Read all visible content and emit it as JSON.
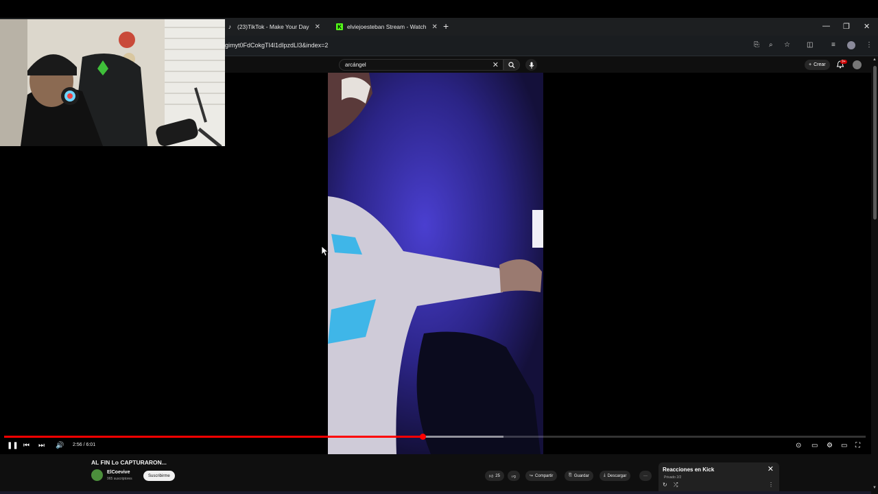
{
  "browser": {
    "tabs": [
      {
        "title": "(23)TikTok - Make Your Day",
        "icon": "tiktok-icon"
      },
      {
        "title": "elviejoesteban Stream - Watch",
        "icon": "kick-icon"
      }
    ],
    "url": "gimyt0FdCokgTI4l1dIpzdLI3&index=2"
  },
  "youtube": {
    "search_query": "arcángel",
    "create_label": "Crear",
    "notification_count": "9+"
  },
  "player": {
    "time_display": "2:56 / 6:01",
    "played_fraction": 0.486,
    "buffered_fraction": 0.58
  },
  "video": {
    "title": "AL FIN Lo CAPTURARON...",
    "channel": "ElCoevive",
    "subscribers": "965 suscriptores",
    "subscribe_label": "Suscribirme",
    "likes": "25",
    "share_label": "Compartir",
    "save_label": "Guardar",
    "download_label": "Descargar",
    "more_label": "···"
  },
  "playlist": {
    "title": "Reacciones en Kick",
    "subtitle": "Privado 2/2"
  },
  "colors": {
    "progress": "#ff0000",
    "kick_brand": "#53fc18",
    "background": "#0f0f0f"
  }
}
